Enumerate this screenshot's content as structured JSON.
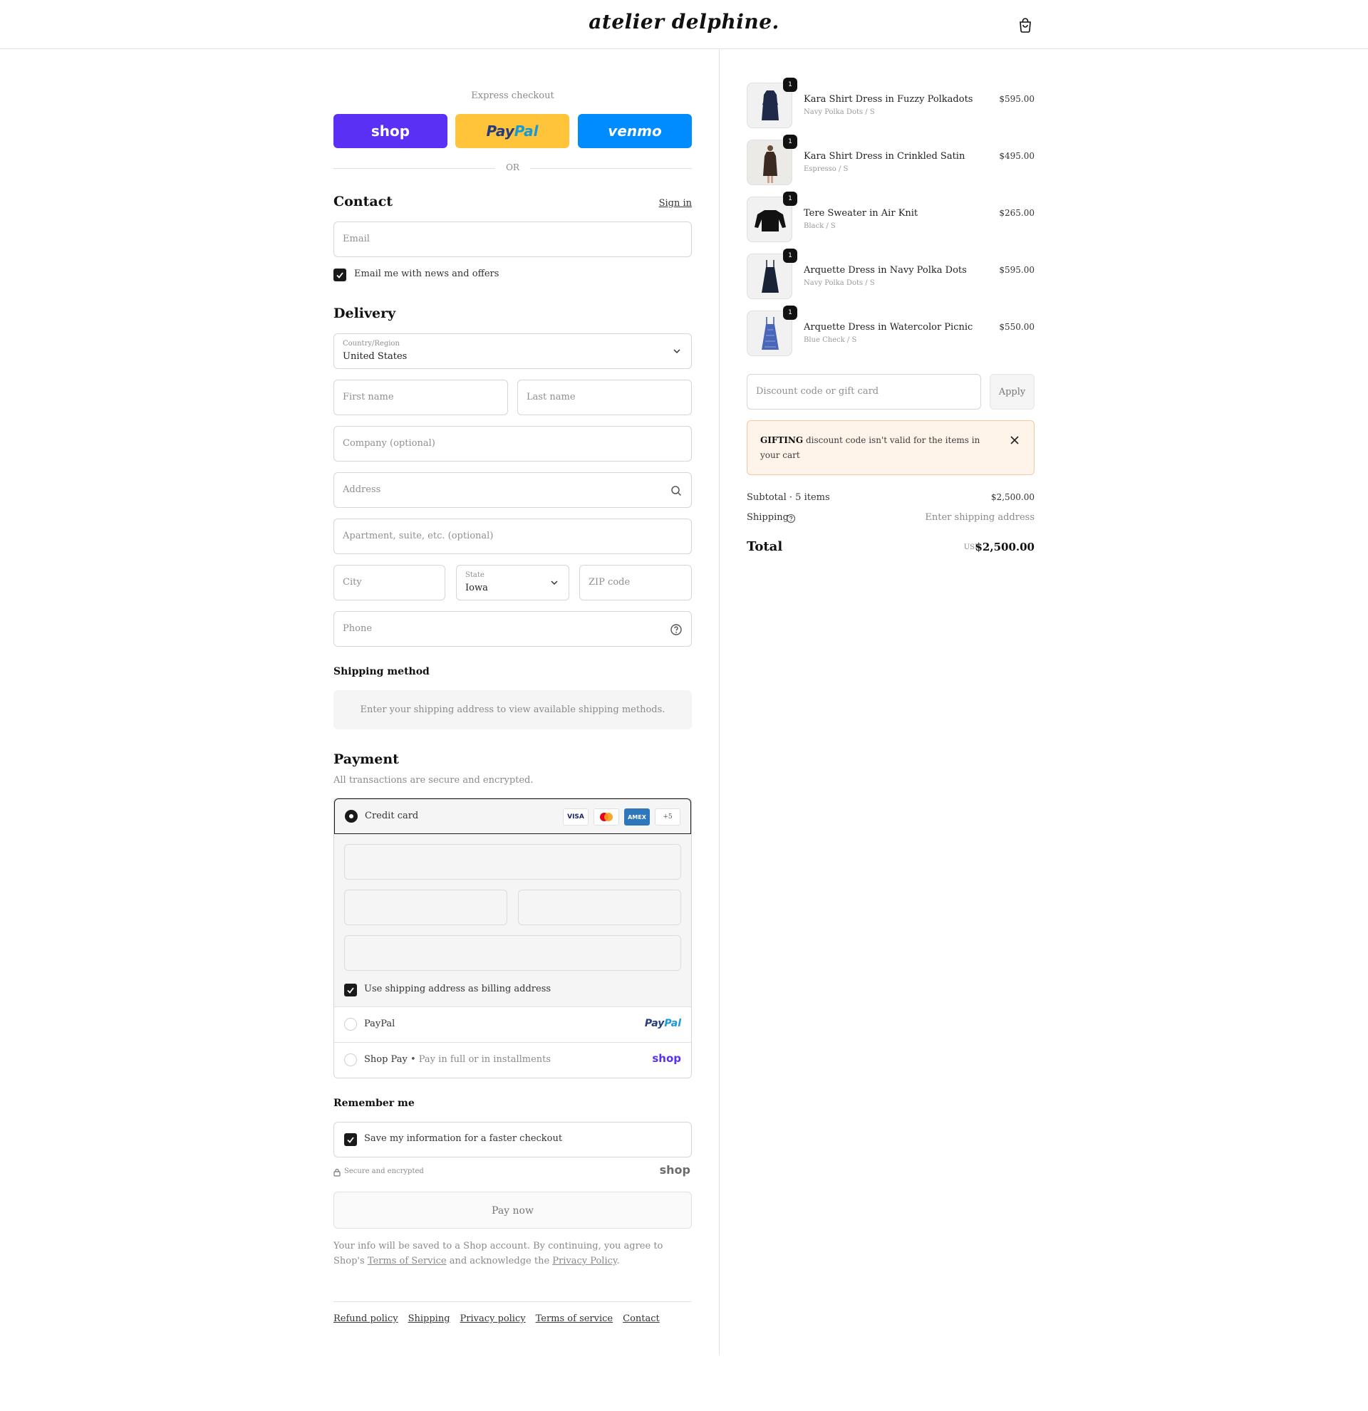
{
  "header": {
    "logo": "atelier delphine."
  },
  "express": {
    "label": "Express checkout",
    "shop_label": "shop",
    "paypal_a": "Pay",
    "paypal_b": "Pal",
    "venmo_label": "venmo",
    "or_label": "OR"
  },
  "contact": {
    "title": "Contact",
    "sign_in": "Sign in",
    "email_placeholder": "Email",
    "news_label": "Email me with news and offers"
  },
  "delivery": {
    "title": "Delivery",
    "country_label": "Country/Region",
    "country_value": "United States",
    "first_name": "First name",
    "last_name": "Last name",
    "company": "Company (optional)",
    "address": "Address",
    "apartment": "Apartment, suite, etc. (optional)",
    "city": "City",
    "state_label": "State",
    "state_value": "Iowa",
    "zip": "ZIP code",
    "phone": "Phone"
  },
  "shipping": {
    "title": "Shipping method",
    "info": "Enter your shipping address to view available shipping methods."
  },
  "payment": {
    "title": "Payment",
    "subtitle": "All transactions are secure and encrypted.",
    "credit_card": "Credit card",
    "visa": "VISA",
    "amex": "AMEX",
    "more_cards": "+5",
    "billing_label": "Use shipping address as billing address",
    "paypal_label": "PayPal",
    "paypal_logo_a": "Pay",
    "paypal_logo_b": "Pal",
    "shoppay_label": "Shop Pay",
    "shoppay_sub": "Pay in full or in installments",
    "shop_logo": "shop"
  },
  "remember": {
    "title": "Remember me",
    "save_label": "Save my information for a faster checkout",
    "secure_label": "Secure and encrypted",
    "shop_logo": "shop"
  },
  "paynow": {
    "label": "Pay now"
  },
  "legal": {
    "part1": "Your info will be saved to a Shop account. By continuing, you agree to Shop's ",
    "terms": "Terms of Service",
    "part2": " and acknowledge the ",
    "privacy": "Privacy Policy",
    "part3": "."
  },
  "footer": {
    "links": [
      "Refund policy",
      "Shipping",
      "Privacy policy",
      "Terms of service",
      "Contact"
    ]
  },
  "cart": {
    "items": [
      {
        "name": "Kara Shirt Dress in Fuzzy Polkadots",
        "variant": "Navy Polka Dots / S",
        "price": "$595.00",
        "qty": "1"
      },
      {
        "name": "Kara Shirt Dress in Crinkled Satin",
        "variant": "Espresso / S",
        "price": "$495.00",
        "qty": "1"
      },
      {
        "name": "Tere Sweater in Air Knit",
        "variant": "Black / S",
        "price": "$265.00",
        "qty": "1"
      },
      {
        "name": "Arquette Dress in Navy Polka Dots",
        "variant": "Navy Polka Dots / S",
        "price": "$595.00",
        "qty": "1"
      },
      {
        "name": "Arquette Dress in Watercolor Picnic",
        "variant": "Blue Check / S",
        "price": "$550.00",
        "qty": "1"
      }
    ],
    "discount_placeholder": "Discount code or gift card",
    "apply_label": "Apply",
    "alert_code": "GIFTING",
    "alert_text": " discount code isn't valid for the items in your cart",
    "subtotal_label": "Subtotal · 5 items",
    "subtotal_value": "$2,500.00",
    "shipping_label": "Shipping",
    "shipping_value": "Enter shipping address",
    "total_label": "Total",
    "currency": "USD",
    "total_value": "$2,500.00"
  }
}
